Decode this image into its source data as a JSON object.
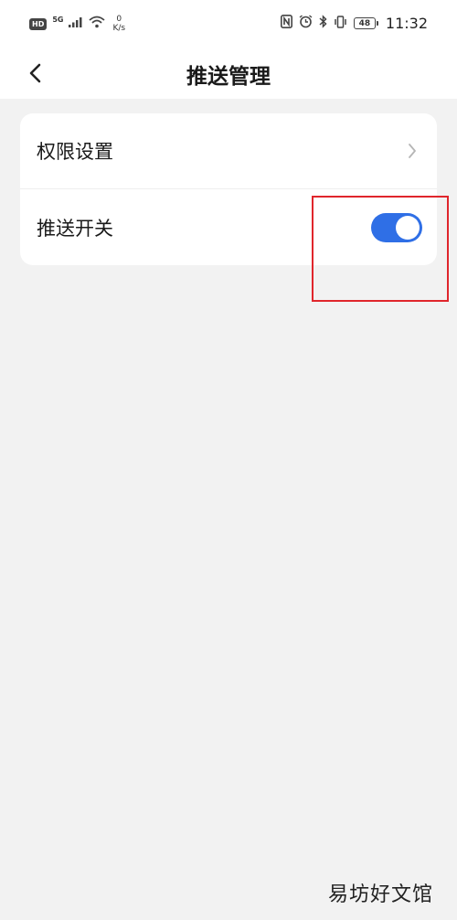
{
  "status_bar": {
    "hd": "HD",
    "signal": "5G",
    "speed_value": "0",
    "speed_unit": "K/s",
    "battery": "48",
    "time": "11:32"
  },
  "header": {
    "title": "推送管理"
  },
  "settings": {
    "permission_label": "权限设置",
    "push_switch_label": "推送开关",
    "push_switch_on": true
  },
  "colors": {
    "toggle_on": "#2f6fe6",
    "highlight": "#e0262c"
  },
  "watermark": "易坊好文馆"
}
